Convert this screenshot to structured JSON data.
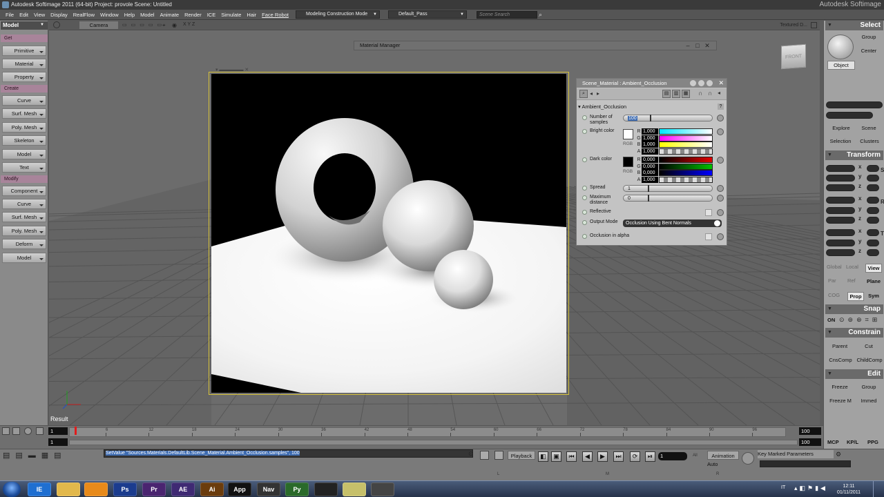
{
  "window": {
    "title": "Autodesk Softimage 2011 (64-bit)   Project: provole   Scene: Untitled",
    "brand": "Autodesk Softimage"
  },
  "menu": {
    "items": [
      "File",
      "Edit",
      "View",
      "Display",
      "RealFlow",
      "Window",
      "Help",
      "Model",
      "Animate",
      "Render",
      "ICE",
      "Simulate",
      "Hair",
      "Face Robot"
    ],
    "mode": "Modeling Construction Mode",
    "pass": "Default_Pass",
    "search_placeholder": "Scene Search"
  },
  "left_panel": {
    "title": "Model",
    "get_label": "Get",
    "get_items": [
      "Primitive",
      "Material",
      "Property"
    ],
    "create_label": "Create",
    "create_items": [
      "Curve",
      "Surf. Mesh",
      "Poly. Mesh",
      "Skeleton",
      "Model",
      "Text"
    ],
    "modify_label": "Modify",
    "modify_items": [
      "Component",
      "Curve",
      "Surf. Mesh",
      "Poly. Mesh",
      "Deform",
      "Model"
    ]
  },
  "viewport": {
    "camera": "Camera",
    "axes_label": "X Y Z",
    "display_mode": "Textured D...",
    "result_label": "Result",
    "cube_label": "FRONT"
  },
  "material_manager": {
    "title": "Material Manager"
  },
  "property_panel": {
    "title": "Scene_Material : Ambient_Occlusion",
    "section": "Ambient_Occlusion",
    "samples_label": "Number of samples",
    "samples_value": "100",
    "bright_label": "Bright color",
    "dark_label": "Dark color",
    "rgb_label": "RGB",
    "bright_channels": [
      {
        "c": "R",
        "v": "1,000"
      },
      {
        "c": "G",
        "v": "1,000"
      },
      {
        "c": "B",
        "v": "1,000"
      },
      {
        "c": "A",
        "v": "1,000"
      }
    ],
    "dark_channels": [
      {
        "c": "R",
        "v": "0,000"
      },
      {
        "c": "G",
        "v": "0,000"
      },
      {
        "c": "B",
        "v": "0,000"
      },
      {
        "c": "A",
        "v": "1,000"
      }
    ],
    "spread_label": "Spread",
    "spread_value": "1",
    "maxdist_label": "Maximum distance",
    "maxdist_value": "0",
    "reflective_label": "Reflective",
    "output_label": "Output Mode",
    "output_value": "Occlusion Using Bent Normals",
    "alpha_label": "Occlusion in alpha"
  },
  "right_panel": {
    "select_title": "Select",
    "group_btn": "Group",
    "center_btn": "Center",
    "object_btn": "Object",
    "explore_btn": "Explore",
    "scene_btn": "Scene",
    "selection_btn": "Selection",
    "clusters_btn": "Clusters",
    "transform_title": "Transform",
    "axes": [
      "x",
      "y",
      "z"
    ],
    "ref_modes": [
      "Global",
      "Local",
      "View",
      "Par",
      "Ref",
      "Plane",
      "COG",
      "Prop",
      "Sym"
    ],
    "snap_title": "Snap",
    "snap_on": "ON",
    "constrain_title": "Constrain",
    "parent_btn": "Parent",
    "cut_btn": "Cut",
    "cnscomp_btn": "CnsComp",
    "childcomp_btn": "ChildComp",
    "edit_title": "Edit",
    "freeze_btn": "Freeze",
    "group2_btn": "Group",
    "freezem_btn": "Freeze M",
    "immed_btn": "Immed"
  },
  "timeline": {
    "start": "1",
    "start2": "1",
    "end": "100",
    "end2": "100",
    "ticks": [
      "6",
      "12",
      "18",
      "24",
      "30",
      "36",
      "42",
      "48",
      "54",
      "60",
      "66",
      "72",
      "78",
      "84",
      "90",
      "96"
    ],
    "tabs": [
      "MCP",
      "KP/L",
      "PPG"
    ]
  },
  "command": {
    "text": "SetValue \"Sources.Materials.DefaultLib.Scene_Material.Ambient_Occlusion.samples\", 100",
    "playback": "Playback",
    "frame": "1",
    "all_label": "All",
    "animation": "Animation",
    "auto": "Auto",
    "key_marked": "Key Marked Parameters",
    "bottom_letters": [
      "L",
      "M",
      "R"
    ]
  },
  "taskbar": {
    "apps": [
      "IE",
      "Explorer",
      "Media",
      "Ps",
      "Pr",
      "AE",
      "Ai",
      "App",
      "Nav",
      "Py",
      "Softimage",
      "Folder",
      "Tool"
    ],
    "lang": "IT",
    "time": "12:11",
    "date": "01/11/2011"
  }
}
